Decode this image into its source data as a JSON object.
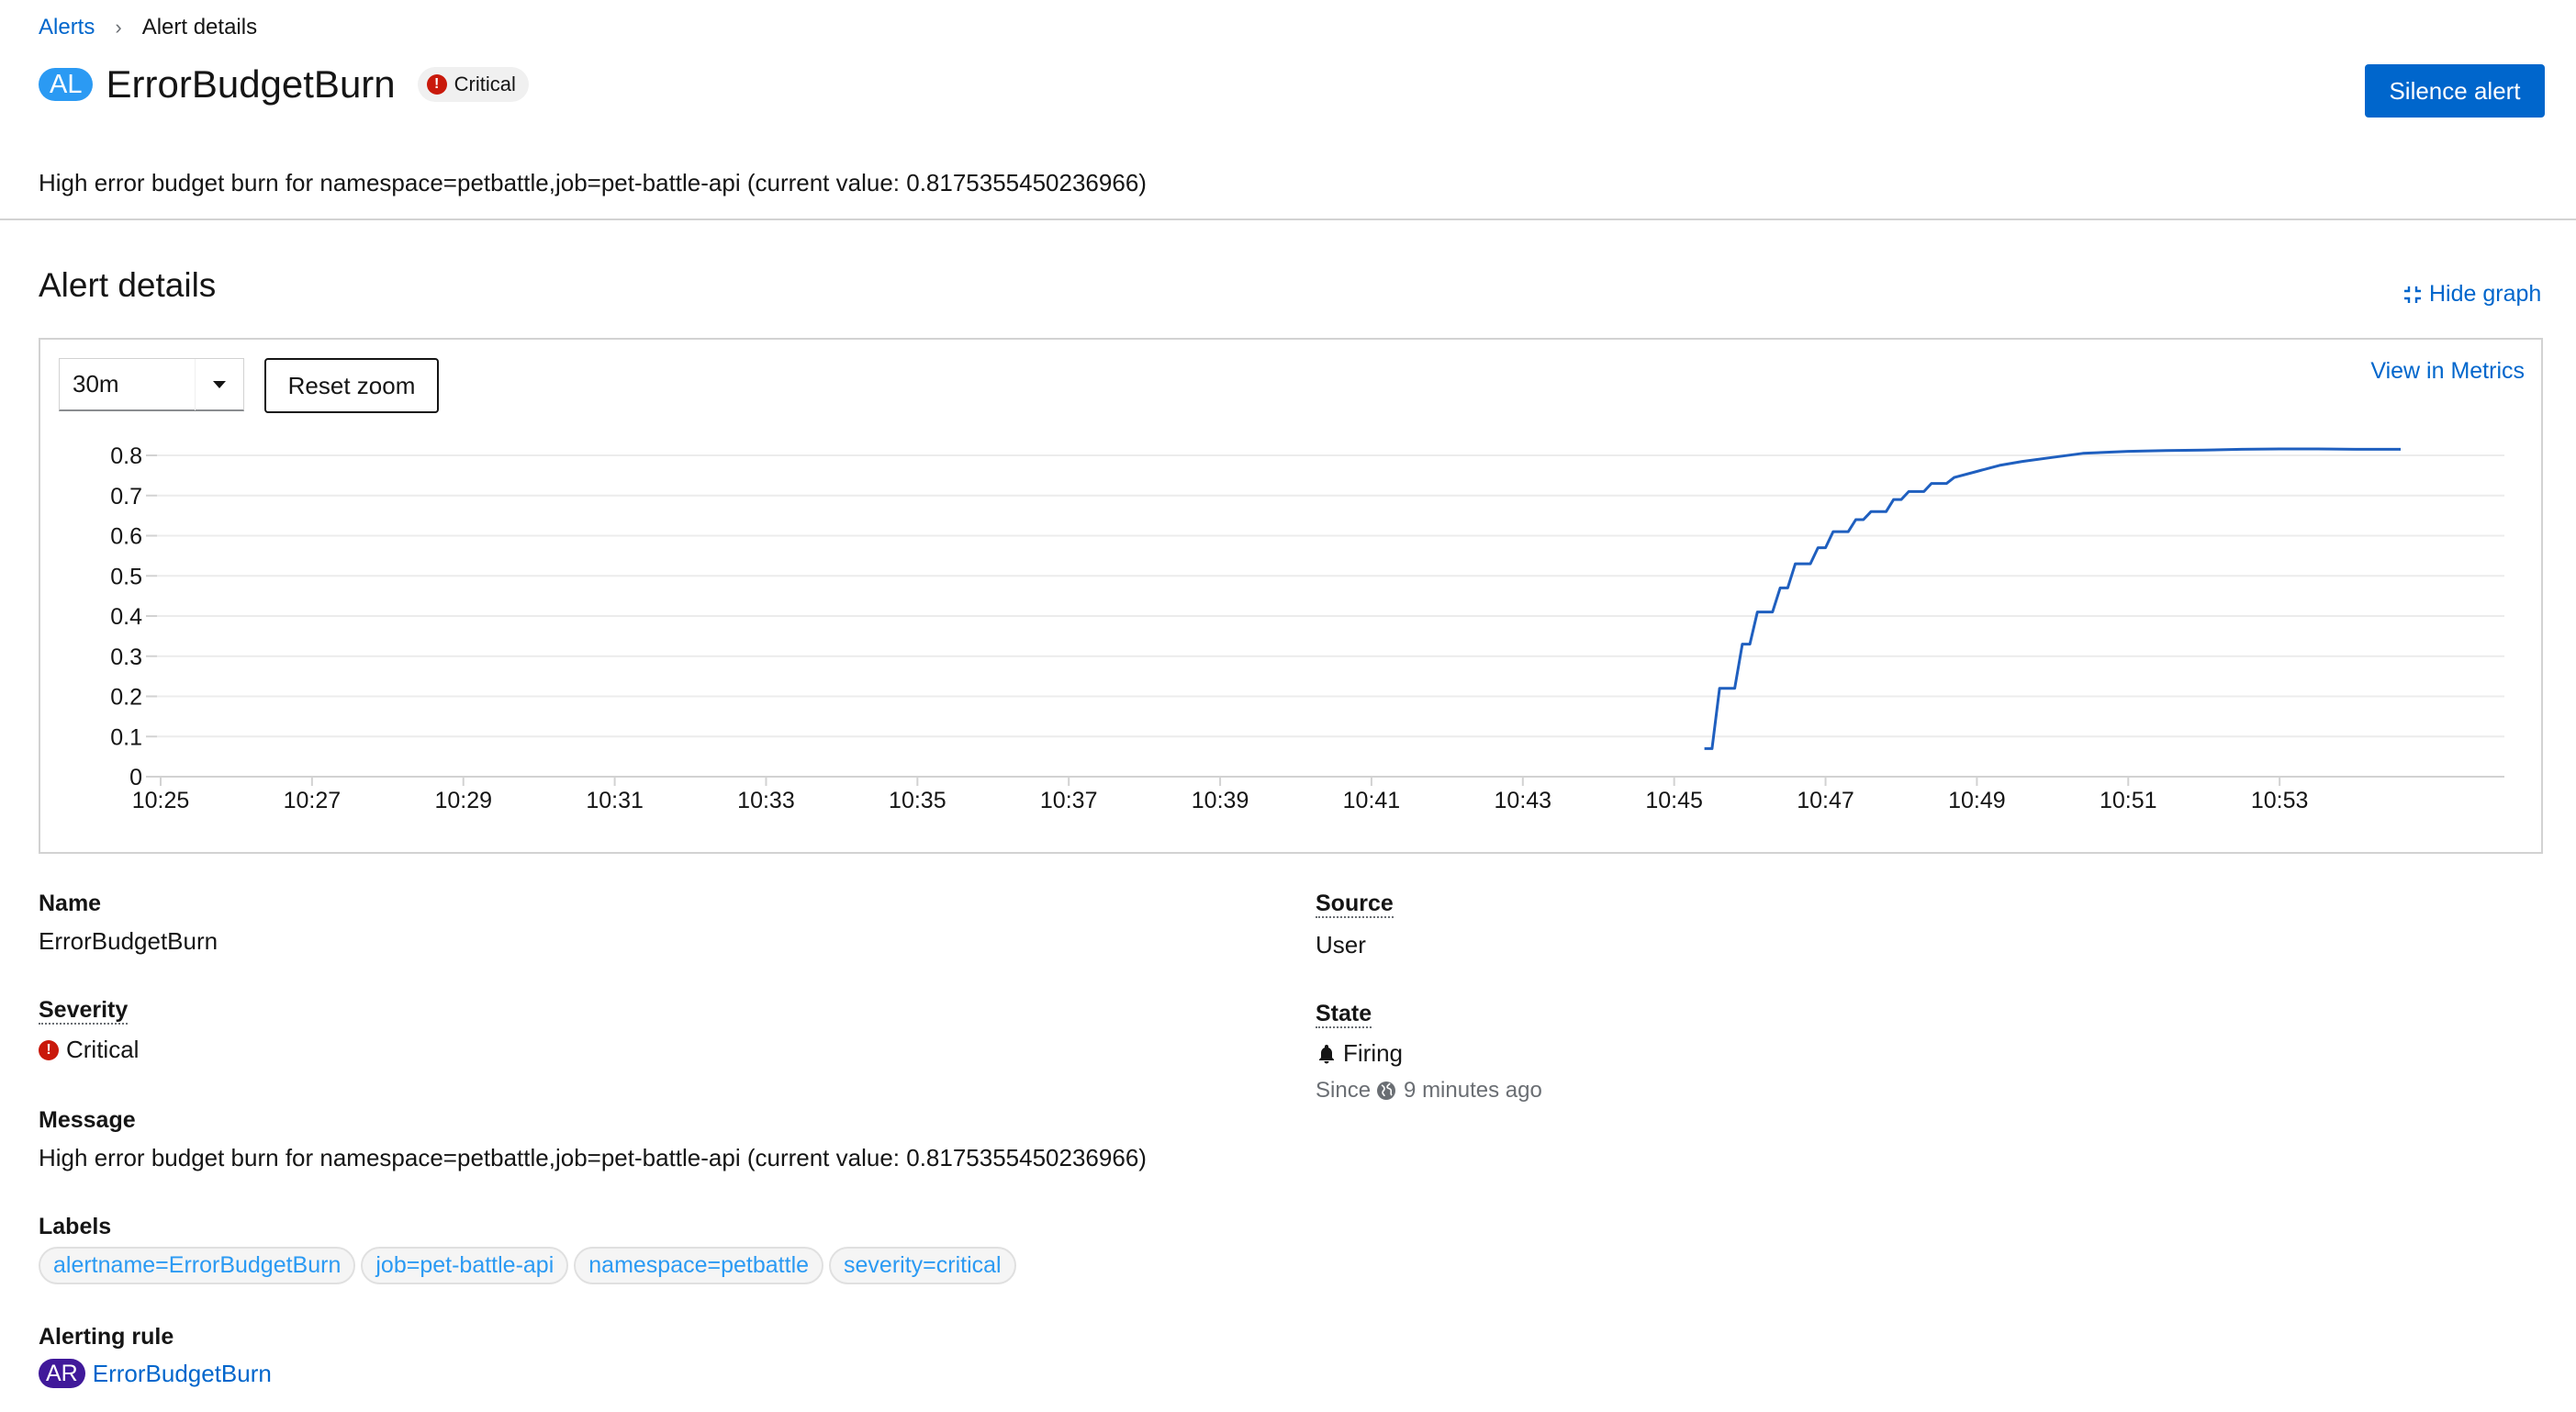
{
  "breadcrumb": {
    "root": "Alerts",
    "current": "Alert details"
  },
  "header": {
    "badge": "AL",
    "title": "ErrorBudgetBurn",
    "severity_pill": "Critical",
    "silence_button": "Silence alert",
    "description": "High error budget burn for namespace=petbattle,job=pet-battle-api (current value: 0.8175355450236966)"
  },
  "section": {
    "title": "Alert details",
    "hide_graph": "Hide graph"
  },
  "graph": {
    "range_select": "30m",
    "reset_zoom": "Reset zoom",
    "view_in_metrics": "View in Metrics"
  },
  "chart_data": {
    "type": "line",
    "x": [
      "10:25",
      "10:27",
      "10:29",
      "10:31",
      "10:33",
      "10:35",
      "10:37",
      "10:39",
      "10:41",
      "10:43",
      "10:45",
      "10:47",
      "10:49",
      "10:51",
      "10:53"
    ],
    "y_ticks": [
      "0",
      "0.1",
      "0.2",
      "0.3",
      "0.4",
      "0.5",
      "0.6",
      "0.7",
      "0.8"
    ],
    "ylim": [
      0,
      0.8
    ],
    "xlim_minutes": [
      0,
      30
    ],
    "series": [
      {
        "color": "#1f5fbf",
        "points": [
          [
            20.4,
            0.07
          ],
          [
            20.5,
            0.07
          ],
          [
            20.6,
            0.22
          ],
          [
            20.8,
            0.22
          ],
          [
            20.9,
            0.33
          ],
          [
            21.0,
            0.33
          ],
          [
            21.1,
            0.41
          ],
          [
            21.3,
            0.41
          ],
          [
            21.4,
            0.47
          ],
          [
            21.5,
            0.47
          ],
          [
            21.6,
            0.53
          ],
          [
            21.8,
            0.53
          ],
          [
            21.9,
            0.57
          ],
          [
            22.0,
            0.57
          ],
          [
            22.1,
            0.61
          ],
          [
            22.3,
            0.61
          ],
          [
            22.4,
            0.64
          ],
          [
            22.5,
            0.64
          ],
          [
            22.6,
            0.66
          ],
          [
            22.8,
            0.66
          ],
          [
            22.9,
            0.69
          ],
          [
            23.0,
            0.69
          ],
          [
            23.1,
            0.71
          ],
          [
            23.3,
            0.71
          ],
          [
            23.4,
            0.73
          ],
          [
            23.6,
            0.73
          ],
          [
            23.7,
            0.745
          ],
          [
            24.0,
            0.76
          ],
          [
            24.3,
            0.775
          ],
          [
            24.6,
            0.785
          ],
          [
            25.0,
            0.795
          ],
          [
            25.4,
            0.805
          ],
          [
            26.0,
            0.81
          ],
          [
            26.5,
            0.812
          ],
          [
            27.0,
            0.813
          ],
          [
            27.5,
            0.815
          ],
          [
            28.0,
            0.816
          ],
          [
            28.5,
            0.816
          ],
          [
            29.0,
            0.815
          ],
          [
            29.6,
            0.815
          ]
        ]
      }
    ]
  },
  "details": {
    "name_label": "Name",
    "name_value": "ErrorBudgetBurn",
    "severity_label": "Severity",
    "severity_value": "Critical",
    "message_label": "Message",
    "message_value": "High error budget burn for namespace=petbattle,job=pet-battle-api (current value: 0.8175355450236966)",
    "labels_label": "Labels",
    "labels": [
      "alertname=ErrorBudgetBurn",
      "job=pet-battle-api",
      "namespace=petbattle",
      "severity=critical"
    ],
    "alerting_rule_label": "Alerting rule",
    "rule_badge": "AR",
    "rule_name": "ErrorBudgetBurn",
    "source_label": "Source",
    "source_value": "User",
    "state_label": "State",
    "state_value": "Firing",
    "since_prefix": "Since",
    "since_value": "9 minutes ago"
  },
  "colors": {
    "primary": "#0066cc",
    "critical": "#c9190b",
    "label_chip": "#2b9af3",
    "rule_badge": "#40199a"
  },
  "icons": [
    "chevron-right-icon",
    "exclamation-circle-icon",
    "compress-icon",
    "caret-down-icon",
    "bell-icon",
    "globe-icon"
  ]
}
